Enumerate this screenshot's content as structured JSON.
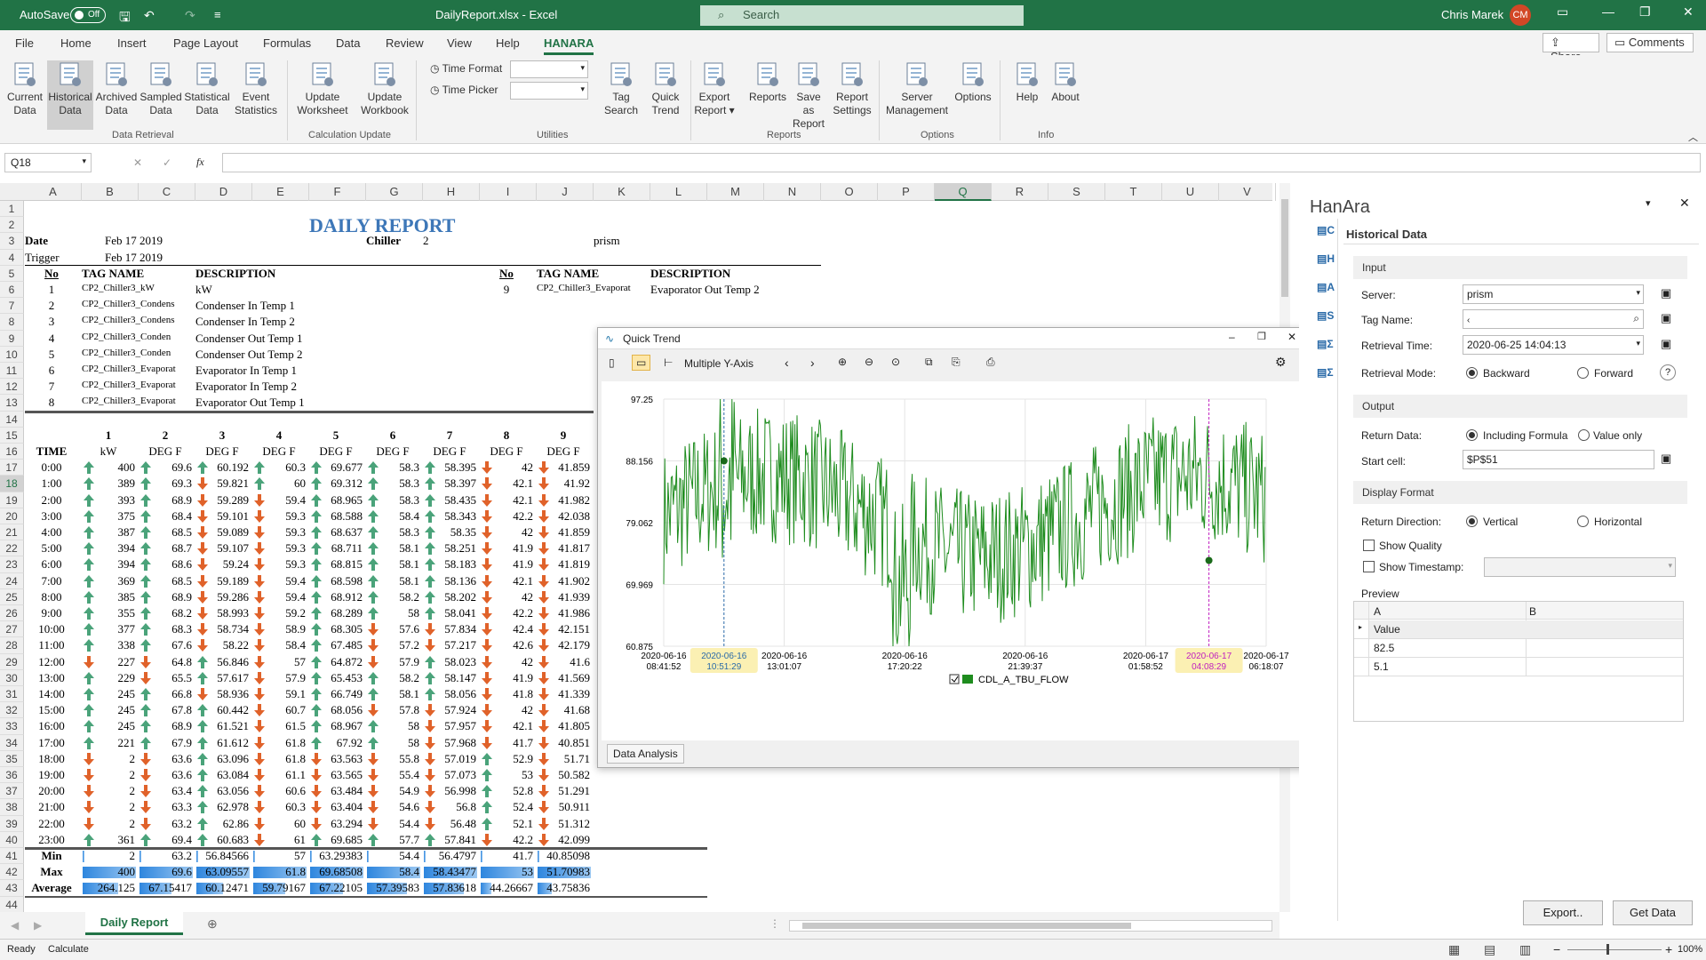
{
  "app": {
    "autosave_label": "AutoSave",
    "autosave_state": "Off",
    "file_title": "DailyReport.xlsx - Excel",
    "search_placeholder": "Search",
    "user_name": "Chris Marek",
    "user_initials": "CM",
    "accent": "#217346"
  },
  "menu": {
    "items": [
      "File",
      "Home",
      "Insert",
      "Page Layout",
      "Formulas",
      "Data",
      "Review",
      "View",
      "Help",
      "HANARA"
    ],
    "active": "HANARA",
    "share": "Share",
    "comments": "Comments"
  },
  "ribbon": {
    "buttons": [
      {
        "label": "Current\nData",
        "icon": "current-data-icon"
      },
      {
        "label": "Historical\nData",
        "icon": "historical-data-icon"
      },
      {
        "label": "Archived\nData",
        "icon": "archived-data-icon"
      },
      {
        "label": "Sampled\nData",
        "icon": "sampled-data-icon"
      },
      {
        "label": "Statistical\nData",
        "icon": "statistical-data-icon"
      },
      {
        "label": "Event\nStatistics",
        "icon": "event-statistics-icon"
      },
      {
        "label": "Update\nWorksheet",
        "icon": "update-worksheet-icon"
      },
      {
        "label": "Update\nWorkbook",
        "icon": "update-workbook-icon"
      },
      {
        "label": "Tag\nSearch",
        "icon": "tag-search-icon"
      },
      {
        "label": "Quick\nTrend",
        "icon": "quick-trend-icon"
      },
      {
        "label": "Export\nReport ▾",
        "icon": "export-report-icon"
      },
      {
        "label": "Reports",
        "icon": "reports-icon"
      },
      {
        "label": "Save as\nReport",
        "icon": "save-as-report-icon"
      },
      {
        "label": "Report\nSettings",
        "icon": "report-settings-icon"
      },
      {
        "label": "Server\nManagement",
        "icon": "server-management-icon"
      },
      {
        "label": "Options",
        "icon": "options-icon"
      },
      {
        "label": "Help",
        "icon": "help-icon"
      },
      {
        "label": "About",
        "icon": "about-icon"
      }
    ],
    "time_format": "Time Format",
    "time_picker": "Time Picker",
    "groups": [
      "Data Retrieval",
      "Calculation Update",
      "Utilities",
      "Reports",
      "Options",
      "Info"
    ]
  },
  "formula_bar": {
    "name_box": "Q18",
    "formula": "",
    "fx": "fx"
  },
  "columns": [
    "A",
    "B",
    "C",
    "D",
    "E",
    "F",
    "G",
    "H",
    "I",
    "J",
    "K",
    "L",
    "M",
    "N",
    "O",
    "P",
    "Q",
    "R",
    "S",
    "T",
    "U",
    "V"
  ],
  "sheet": {
    "title": "DAILY REPORT",
    "date_label": "Date",
    "date_value": "Feb 17 2019",
    "chiller_label": "Chiller",
    "chiller_value": "2",
    "server_value": "prism",
    "trigger_label": "Trigger",
    "trigger_value": "Feb 17 2019",
    "tag_headers": [
      "No",
      "TAG NAME",
      "DESCRIPTION"
    ],
    "tags": [
      [
        "1",
        "CP2_Chiller3_kW",
        "kW"
      ],
      [
        "2",
        "CP2_Chiller3_Condens",
        "Condenser In Temp 1"
      ],
      [
        "3",
        "CP2_Chiller3_Condens",
        "Condenser In Temp 2"
      ],
      [
        "4",
        "CP2_Chiller3_Conden",
        "Condenser Out Temp 1"
      ],
      [
        "5",
        "CP2_Chiller3_Conden",
        "Condenser Out Temp 2"
      ],
      [
        "6",
        "CP2_Chiller3_Evaporat",
        "Evaporator In Temp 1"
      ],
      [
        "7",
        "CP2_Chiller3_Evaporat",
        "Evaporator In Temp 2"
      ],
      [
        "8",
        "CP2_Chiller3_Evaporat",
        "Evaporator Out Temp 1"
      ]
    ],
    "tag9": [
      "9",
      "CP2_Chiller3_Evaporat",
      "Evaporator Out Temp 2"
    ],
    "table_nums": [
      "1",
      "2",
      "3",
      "4",
      "5",
      "6",
      "7",
      "8",
      "9"
    ],
    "units": [
      "TIME",
      "kW",
      "DEG F",
      "DEG F",
      "DEG F",
      "DEG F",
      "DEG F",
      "DEG F",
      "DEG F",
      "DEG F"
    ],
    "rows": [
      [
        "0:00",
        "u",
        "400",
        "u",
        "69.6",
        "u",
        "60.192",
        "u",
        "60.3",
        "u",
        "69.677",
        "u",
        "58.3",
        "u",
        "58.395",
        "d",
        "42",
        "d",
        "41.859"
      ],
      [
        "1:00",
        "u",
        "389",
        "u",
        "69.3",
        "d",
        "59.821",
        "u",
        "60",
        "u",
        "69.312",
        "u",
        "58.3",
        "u",
        "58.397",
        "d",
        "42.1",
        "d",
        "41.92"
      ],
      [
        "2:00",
        "u",
        "393",
        "u",
        "68.9",
        "d",
        "59.289",
        "d",
        "59.4",
        "u",
        "68.965",
        "u",
        "58.3",
        "u",
        "58.435",
        "d",
        "42.1",
        "d",
        "41.982"
      ],
      [
        "3:00",
        "u",
        "375",
        "u",
        "68.4",
        "d",
        "59.101",
        "d",
        "59.3",
        "u",
        "68.588",
        "u",
        "58.4",
        "u",
        "58.343",
        "d",
        "42.2",
        "d",
        "42.038"
      ],
      [
        "4:00",
        "u",
        "387",
        "u",
        "68.5",
        "d",
        "59.089",
        "d",
        "59.3",
        "u",
        "68.637",
        "u",
        "58.3",
        "u",
        "58.35",
        "d",
        "42",
        "d",
        "41.859"
      ],
      [
        "5:00",
        "u",
        "394",
        "u",
        "68.7",
        "d",
        "59.107",
        "d",
        "59.3",
        "u",
        "68.711",
        "u",
        "58.1",
        "u",
        "58.251",
        "d",
        "41.9",
        "d",
        "41.817"
      ],
      [
        "6:00",
        "u",
        "394",
        "u",
        "68.6",
        "d",
        "59.24",
        "d",
        "59.3",
        "u",
        "68.815",
        "u",
        "58.1",
        "u",
        "58.183",
        "d",
        "41.9",
        "d",
        "41.819"
      ],
      [
        "7:00",
        "u",
        "369",
        "u",
        "68.5",
        "d",
        "59.189",
        "d",
        "59.4",
        "u",
        "68.598",
        "u",
        "58.1",
        "u",
        "58.136",
        "d",
        "42.1",
        "d",
        "41.902"
      ],
      [
        "8:00",
        "u",
        "385",
        "u",
        "68.9",
        "d",
        "59.286",
        "d",
        "59.4",
        "u",
        "68.912",
        "u",
        "58.2",
        "u",
        "58.202",
        "d",
        "42",
        "d",
        "41.939"
      ],
      [
        "9:00",
        "u",
        "355",
        "u",
        "68.2",
        "d",
        "58.993",
        "d",
        "59.2",
        "u",
        "68.289",
        "u",
        "58",
        "u",
        "58.041",
        "d",
        "42.2",
        "d",
        "41.986"
      ],
      [
        "10:00",
        "u",
        "377",
        "u",
        "68.3",
        "d",
        "58.734",
        "d",
        "58.9",
        "u",
        "68.305",
        "d",
        "57.6",
        "d",
        "57.834",
        "d",
        "42.4",
        "d",
        "42.151"
      ],
      [
        "11:00",
        "u",
        "338",
        "u",
        "67.6",
        "d",
        "58.22",
        "d",
        "58.4",
        "u",
        "67.485",
        "d",
        "57.2",
        "d",
        "57.217",
        "d",
        "42.6",
        "d",
        "42.179"
      ],
      [
        "12:00",
        "d",
        "227",
        "d",
        "64.8",
        "u",
        "56.846",
        "d",
        "57",
        "u",
        "64.872",
        "d",
        "57.9",
        "u",
        "58.023",
        "d",
        "42",
        "d",
        "41.6"
      ],
      [
        "13:00",
        "u",
        "229",
        "d",
        "65.5",
        "u",
        "57.617",
        "d",
        "57.9",
        "u",
        "65.453",
        "u",
        "58.2",
        "u",
        "58.147",
        "d",
        "41.9",
        "d",
        "41.569"
      ],
      [
        "14:00",
        "u",
        "245",
        "u",
        "66.8",
        "d",
        "58.936",
        "d",
        "59.1",
        "u",
        "66.749",
        "u",
        "58.1",
        "u",
        "58.056",
        "d",
        "41.8",
        "d",
        "41.339"
      ],
      [
        "15:00",
        "u",
        "245",
        "u",
        "67.8",
        "u",
        "60.442",
        "d",
        "60.7",
        "u",
        "68.056",
        "d",
        "57.8",
        "d",
        "57.924",
        "d",
        "42",
        "d",
        "41.68"
      ],
      [
        "16:00",
        "u",
        "245",
        "u",
        "68.9",
        "u",
        "61.521",
        "d",
        "61.5",
        "u",
        "68.967",
        "u",
        "58",
        "d",
        "57.957",
        "d",
        "42.1",
        "d",
        "41.805"
      ],
      [
        "17:00",
        "u",
        "221",
        "u",
        "67.9",
        "u",
        "61.612",
        "d",
        "61.8",
        "u",
        "67.92",
        "u",
        "58",
        "d",
        "57.968",
        "d",
        "41.7",
        "d",
        "40.851"
      ],
      [
        "18:00",
        "d",
        "2",
        "d",
        "63.6",
        "u",
        "63.096",
        "d",
        "61.8",
        "d",
        "63.563",
        "d",
        "55.8",
        "d",
        "57.019",
        "u",
        "52.9",
        "d",
        "51.71"
      ],
      [
        "19:00",
        "d",
        "2",
        "d",
        "63.6",
        "u",
        "63.084",
        "d",
        "61.1",
        "d",
        "63.565",
        "d",
        "55.4",
        "d",
        "57.073",
        "u",
        "53",
        "d",
        "50.582"
      ],
      [
        "20:00",
        "d",
        "2",
        "d",
        "63.4",
        "u",
        "63.056",
        "d",
        "60.6",
        "d",
        "63.484",
        "d",
        "54.9",
        "d",
        "56.998",
        "u",
        "52.8",
        "d",
        "51.291"
      ],
      [
        "21:00",
        "d",
        "2",
        "d",
        "63.3",
        "u",
        "62.978",
        "d",
        "60.3",
        "d",
        "63.404",
        "d",
        "54.6",
        "d",
        "56.8",
        "u",
        "52.4",
        "d",
        "50.911"
      ],
      [
        "22:00",
        "d",
        "2",
        "d",
        "63.2",
        "u",
        "62.86",
        "d",
        "60",
        "d",
        "63.294",
        "d",
        "54.4",
        "d",
        "56.48",
        "u",
        "52.1",
        "d",
        "51.312"
      ],
      [
        "23:00",
        "u",
        "361",
        "u",
        "69.4",
        "u",
        "60.683",
        "d",
        "61",
        "u",
        "69.685",
        "u",
        "57.7",
        "u",
        "57.841",
        "d",
        "42.2",
        "d",
        "42.099"
      ]
    ],
    "summary": [
      [
        "Min",
        "2",
        "63.2",
        "56.84566",
        "57",
        "63.29383",
        "54.4",
        "56.4797",
        "41.7",
        "40.85098"
      ],
      [
        "Max",
        "400",
        "69.6",
        "63.09557",
        "61.8",
        "69.68508",
        "58.4",
        "58.43477",
        "53",
        "51.70983"
      ],
      [
        "Average",
        "264.125",
        "67.15417",
        "60.12471",
        "59.79167",
        "67.22105",
        "57.39583",
        "57.83618",
        "44.26667",
        "43.75836"
      ]
    ],
    "summary_bar_fractions": [
      [
        0.005,
        0.0,
        0.0,
        0.0,
        0.0,
        0.0,
        0.0,
        0.0,
        0.0
      ],
      [
        1,
        1,
        1,
        1,
        1,
        1,
        1,
        1,
        1
      ],
      [
        0.66,
        0.6,
        0.5,
        0.6,
        0.62,
        0.75,
        0.75,
        0.2,
        0.26
      ]
    ]
  },
  "sheet_tab": "Daily Report",
  "trend": {
    "title": "Quick Trend",
    "toolbar_axis": "Multiple Y-Axis",
    "y_ticks": [
      "97.25",
      "88.156",
      "79.062",
      "69.969",
      "60.875"
    ],
    "x_ticks": [
      "2020-06-16\n08:41:52",
      "2020-06-16\n13:01:07",
      "2020-06-16\n17:20:22",
      "2020-06-16\n21:39:37",
      "2020-06-17\n01:58:52",
      "2020-06-17\n06:18:07"
    ],
    "cursor1": "2020-06-16\n10:51:29",
    "cursor2": "2020-06-17\n04:08:29",
    "legend": "CDL_A_TBU_FLOW",
    "series_color": "#1e8c1e",
    "tab": "Data Analysis"
  },
  "panel": {
    "app": "HanAra",
    "title": "Historical Data",
    "input_section": "Input",
    "server_label": "Server:",
    "server_value": "prism",
    "tag_label": "Tag Name:",
    "tag_value": "",
    "time_label": "Retrieval Time:",
    "time_value": "2020-06-25 14:04:13",
    "mode_label": "Retrieval Mode:",
    "mode_backward": "Backward",
    "mode_forward": "Forward",
    "output_section": "Output",
    "return_label": "Return Data:",
    "return_formula": "Including Formula",
    "return_value_only": "Value only",
    "start_label": "Start cell:",
    "start_value": "$P$51",
    "display_section": "Display Format",
    "dir_label": "Return Direction:",
    "dir_vertical": "Vertical",
    "dir_horizontal": "Horizontal",
    "show_quality": "Show Quality",
    "show_timestamp": "Show Timestamp:",
    "preview_label": "Preview",
    "preview_cols": [
      "A",
      "B"
    ],
    "preview_rows": [
      "Value",
      "82.5",
      "5.1"
    ],
    "export_btn": "Export..",
    "get_btn": "Get Data"
  },
  "status": {
    "ready": "Ready",
    "calculate": "Calculate",
    "zoom": "100%"
  }
}
